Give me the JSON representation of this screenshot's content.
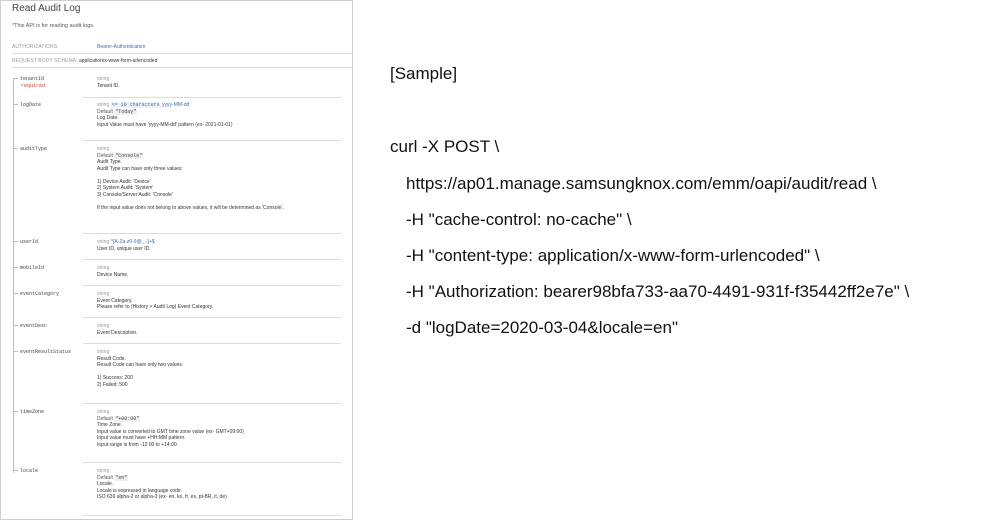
{
  "panel": {
    "title": "Read Audit Log",
    "description": "*This API is for reading audit logs.",
    "authorizations_label": "AUTHORIZATIONS:",
    "authorizations_value": "Bearer-Authentication",
    "schema_label": "REQUEST BODY SCHEMA:",
    "schema_value": "application/x-www-form-urlencoded"
  },
  "params": [
    {
      "name": "tenantId",
      "required": "required",
      "type": "string",
      "lines": [
        "Tenant ID."
      ]
    },
    {
      "name": "logDate",
      "type": "string",
      "constraint": "<= 10 characters",
      "format": "yyyy-MM-dd",
      "default": "\"Today\"",
      "lines": [
        "Log Date.",
        "Input Value must have 'yyyy-MM-dd' pattern (ex- 2021-01-01)"
      ]
    },
    {
      "name": "auditType",
      "type": "string",
      "default": "\"Console\"",
      "lines": [
        "Audit Type.",
        "Audit Type can have only three values:",
        "",
        "1) Device Audit: 'Device'",
        "2) System Audit: 'System'",
        "3) Console/Server Audit: 'Console'",
        "",
        "If the input value does not belong to above values, it will be determined as 'Console'."
      ]
    },
    {
      "name": "userId",
      "type": "string",
      "format": "^[A-Za-z0-9@_.-]+$",
      "lines": [
        "User ID, unique user ID."
      ]
    },
    {
      "name": "mobileId",
      "type": "string",
      "lines": [
        "Device Name."
      ]
    },
    {
      "name": "eventCategory",
      "type": "string",
      "lines": [
        "Event Category.",
        "Please refer to (History > Audit Log) Event Category."
      ]
    },
    {
      "name": "eventDesc",
      "type": "string",
      "lines": [
        "Event Description."
      ]
    },
    {
      "name": "eventResultStatus",
      "type": "string",
      "lines": [
        "Result Code.",
        "Result Code can have only two values:",
        "",
        "1) Success: 200",
        "2) Failed: 500"
      ]
    },
    {
      "name": "timeZone",
      "type": "string",
      "default": "\"+00:00\"",
      "lines": [
        "Time Zone.",
        "Input value is converted to GMT time zone value (ex- GMT+09:00)",
        "Input value must have +HH:MM pattern.",
        "Input range is from -12:00 to +14:00."
      ]
    },
    {
      "name": "locale",
      "type": "string",
      "default": "\"en\"",
      "lines": [
        "Locale.",
        "Locale is expressed in language code.",
        "ISO 639 alpha-2 or alpha-3 (ex- en, ko, fr, es, pt-BR, it, de)"
      ]
    }
  ],
  "default_label": "Default",
  "sample": {
    "heading": "[Sample]",
    "lines": [
      "curl -X POST \\",
      "https://ap01.manage.samsungknox.com/emm/oapi/audit/read \\",
      "-H \"cache-control: no-cache\" \\",
      "-H \"content-type: application/x-www-form-urlencoded\" \\",
      "-H \"Authorization: bearer98bfa733-aa70-4491-931f-f35442ff2e7e\" \\",
      "-d \"logDate=2020-03-04&locale=en\""
    ]
  }
}
